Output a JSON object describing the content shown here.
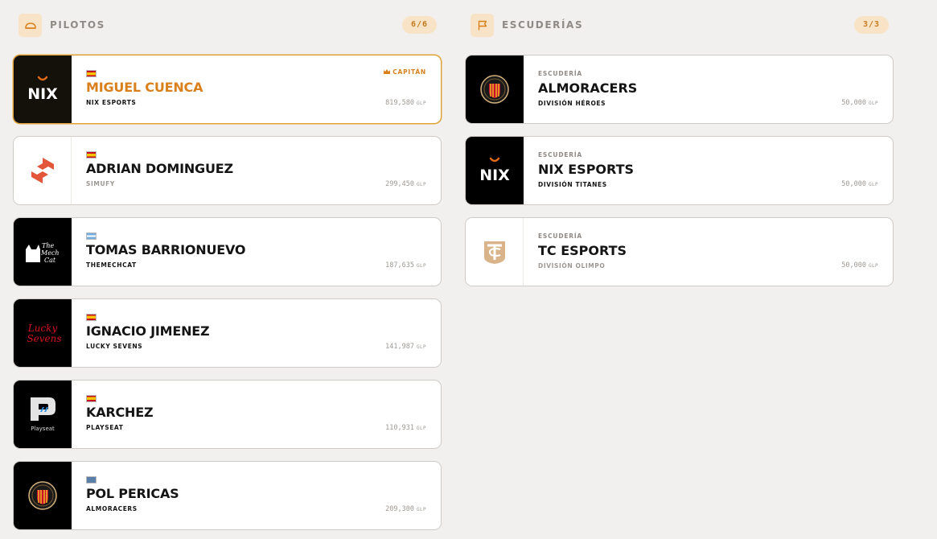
{
  "sections": {
    "drivers": {
      "title": "PILOTOS",
      "count": "6/6",
      "icon": "helmet-icon"
    },
    "teams": {
      "title": "ESCUDERÍAS",
      "count": "3/3",
      "icon": "flag-icon"
    }
  },
  "drivers": [
    {
      "name": "MIGUEL CUENCA",
      "team": "NIX ESPORTS",
      "price": "819,580",
      "unit": "GLP",
      "captain_label": "CAPITÁN",
      "flag": "es",
      "logo": "nix-esports-logo",
      "logo_text": "NIX"
    },
    {
      "name": "ADRIAN DOMINGUEZ",
      "team": "SIMUFY",
      "price": "299,450",
      "unit": "GLP",
      "flag": "es",
      "logo": "simufy-logo"
    },
    {
      "name": "TOMAS BARRIONUEVO",
      "team": "THEMECHCAT",
      "price": "187,635",
      "unit": "GLP",
      "flag": "ar",
      "logo": "themechcat-logo",
      "logo_text": "The Mech Cat"
    },
    {
      "name": "IGNACIO JIMENEZ",
      "team": "LUCKY SEVENS",
      "price": "141,987",
      "unit": "GLP",
      "flag": "es",
      "logo": "lucky-sevens-logo",
      "logo_text": "Lucky Sevens"
    },
    {
      "name": "KARCHEZ",
      "team": "PLAYSEAT",
      "price": "110,931",
      "unit": "GLP",
      "flag": "es",
      "logo": "playseat-logo",
      "logo_text": "Playseat"
    },
    {
      "name": "POL PERICAS",
      "team": "ALMORACERS",
      "price": "209,300",
      "unit": "GLP",
      "flag": "ca",
      "logo": "almoracers-logo"
    }
  ],
  "teams": [
    {
      "kicker": "ESCUDERÍA",
      "name": "ALMORACERS",
      "division": "DIVISIÓN HÉROES",
      "price": "50,000",
      "unit": "GLP",
      "logo": "almoracers-logo"
    },
    {
      "kicker": "ESCUDERÍA",
      "name": "NIX ESPORTS",
      "division": "DIVISIÓN TITANES",
      "price": "50,000",
      "unit": "GLP",
      "logo": "nix-esports-logo",
      "logo_text": "NIX"
    },
    {
      "kicker": "ESCUDERÍA",
      "name": "TC ESPORTS",
      "division": "DIVISIÓN OLIMPO",
      "price": "50,000",
      "unit": "GLP",
      "logo": "tc-esports-logo"
    }
  ],
  "colors": {
    "accent": "#d9801c",
    "badge_bg": "#f8e3c6",
    "page_bg": "#f2f0ee"
  }
}
